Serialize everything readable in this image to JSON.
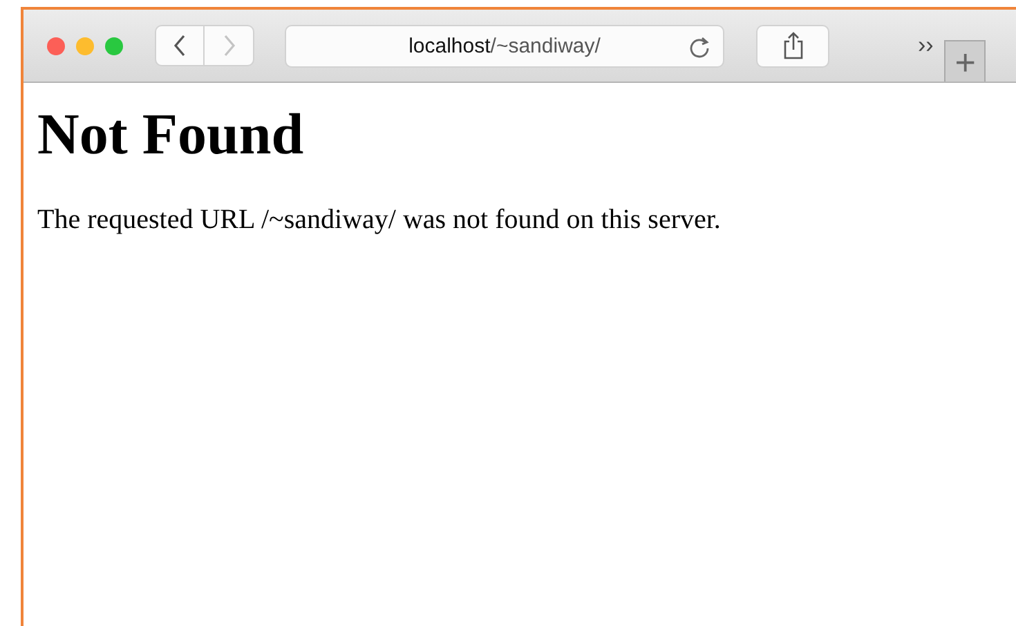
{
  "toolbar": {
    "back": {
      "disabled": false
    },
    "forward": {
      "disabled": true
    },
    "address": {
      "host": "localhost",
      "path": "/~sandiway/"
    },
    "overflow": "››",
    "new_tab": "+"
  },
  "page": {
    "heading": "Not Found",
    "message": "The requested URL /~sandiway/ was not found on this server."
  }
}
